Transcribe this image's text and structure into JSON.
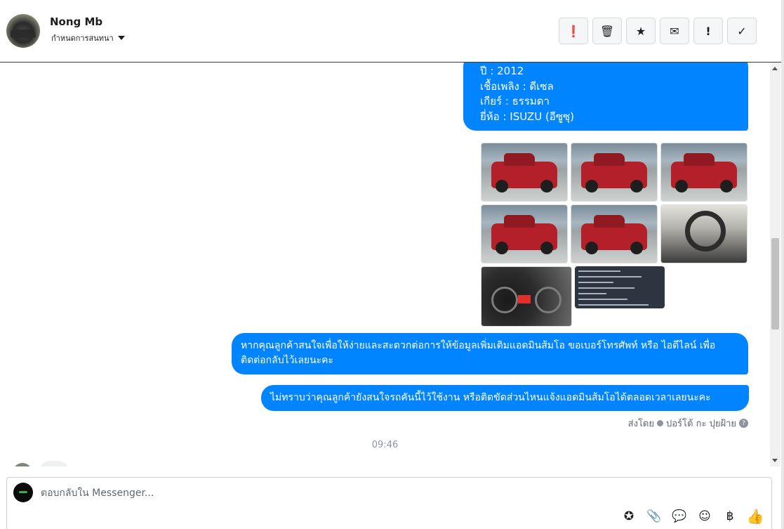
{
  "header": {
    "contact_name": "Nong Mb",
    "assign_label": "กำหนดการสนทนา",
    "tools": [
      {
        "name": "report-icon",
        "glyph": "❗"
      },
      {
        "name": "trash-icon",
        "glyph": "🗑"
      },
      {
        "name": "star-icon",
        "glyph": "★"
      },
      {
        "name": "envelope-icon",
        "glyph": "✉"
      },
      {
        "name": "exclamation-icon",
        "glyph": "!"
      },
      {
        "name": "check-icon",
        "glyph": "✓"
      }
    ]
  },
  "chat": {
    "car_details": [
      "ปี : 2012",
      "เชื้อเพลิง : ดีเซล",
      "เกียร์ : ธรรมดา",
      "ยี่ห้อ : ISUZU (อีซูซุ)"
    ],
    "message_1": "หากคุณลูกค้าสนใจเพื่อให้ง่ายและสะดวกต่อการให้ข้อมูลเพิ่มเติมแอดมินส้มโอ ขอเบอร์โทรศัพท์ หรือ ไอดีไลน์ เพื่อติดต่อกลับไว้เลยนะคะ",
    "message_2": "ไม่ทราบว่าคุณลูกค้ายังสนใจรถคันนี้ไว้ใช้งาน หรือติดขัดส่วนไหนแจ้งแอดมินส้มโอได้ตลอดเวลาเลยนะคะ",
    "sent_by_label": "ส่งโดย",
    "sent_by_name": "ปอร์โต้ กะ ปุยฝ้าย",
    "timestamp": "09:46"
  },
  "composer": {
    "placeholder": "ตอบกลับใน Messenger...",
    "tools": [
      {
        "name": "saved-reply-icon",
        "glyph": "✪"
      },
      {
        "name": "attachment-icon",
        "glyph": "📎"
      },
      {
        "name": "chat-bubble-icon",
        "glyph": "💬"
      },
      {
        "name": "emoji-icon",
        "glyph": "☺"
      },
      {
        "name": "baht-icon",
        "glyph": "฿"
      }
    ],
    "like_glyph": "👍"
  },
  "colors": {
    "bubble": "#0084ff",
    "header_border": "#3a3a3a"
  }
}
